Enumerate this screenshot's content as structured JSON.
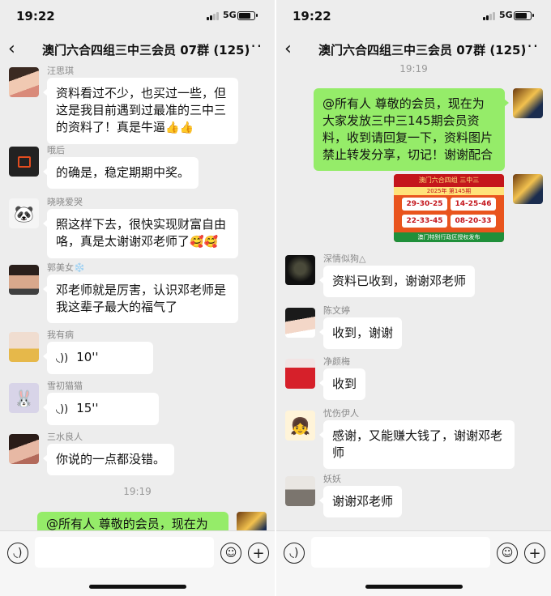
{
  "status_bar": {
    "time": "19:22",
    "network": "5G"
  },
  "chat": {
    "title": "澳门六合四组三中三会员 07群 (125)"
  },
  "left_screen": {
    "messages": [
      {
        "sender": "汪思琪",
        "text": "资料看过不少，也买过一些，但这是我目前遇到过最准的三中三的资料了！真是牛逼",
        "emoji": "👍👍"
      },
      {
        "sender": "哦后",
        "text": "的确是，稳定期期中奖。"
      },
      {
        "sender": "晓晓爱哭",
        "text": "照这样下去，很快实现财富自由咯，真是太谢谢邓老师了",
        "emoji": "🥰🥰"
      },
      {
        "sender": "郭美女",
        "sender_emoji": "❄️",
        "text": "邓老师就是厉害，认识邓老师是我这辈子最大的福气了"
      },
      {
        "sender": "我有病",
        "voice": "10''"
      },
      {
        "sender": "雪初猫猫",
        "voice": "15''"
      },
      {
        "sender": "三水良人",
        "text": "你说的一点都没错。"
      }
    ],
    "timestamp": "19:19",
    "partial_message": "@所有人 尊敬的会员，现在为"
  },
  "right_screen": {
    "timestamp": "19:19",
    "announcement": "@所有人 尊敬的会员，现在为大家发放三中三145期会员资料，收到请回复一下，资料图片禁止转发分享，切记！谢谢配合",
    "image": {
      "header": "澳门六合四组 三中三",
      "year": "2025年 第145期",
      "numbers": [
        "29-30-25",
        "14-25-46",
        "22-33-45",
        "08-20-33"
      ],
      "footer": "澳门特别行政区授权发布"
    },
    "messages": [
      {
        "sender": "深情似狗",
        "sender_suffix": "△",
        "text": "资料已收到，谢谢邓老师"
      },
      {
        "sender": "陈文婷",
        "text": "收到，谢谢"
      },
      {
        "sender": "净颜梅",
        "text": "收到"
      },
      {
        "sender": "忧伤伊人",
        "text": "感谢，又能赚大钱了，谢谢邓老师"
      },
      {
        "sender": "妖妖",
        "text": "谢谢邓老师"
      }
    ]
  },
  "icons": {
    "back": "chevron-left-icon",
    "more": "more-dots-icon",
    "voice_input": "voice-icon",
    "sticker": "emoji-face-icon",
    "plus": "plus-icon"
  },
  "colors": {
    "background": "#ededed",
    "own_bubble": "#95ec69",
    "other_bubble": "#ffffff"
  }
}
